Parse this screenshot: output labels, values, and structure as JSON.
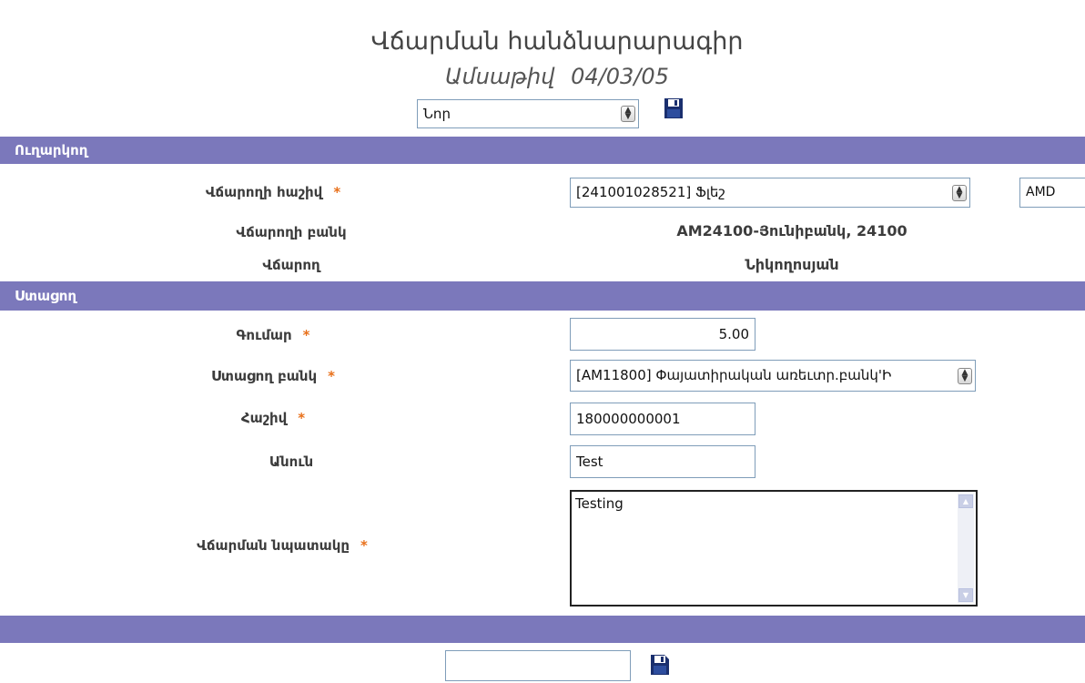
{
  "header": {
    "title": "Վճարման հանձնարարագիր",
    "date_label": "Ամսաթիվ",
    "date_value": "04/03/05",
    "template_select_value": "Նոր",
    "save_icon": "floppy-disk-icon"
  },
  "sender_section": {
    "title": "Ուղարկող",
    "payer_account_label": "Վճարողի հաշիվ",
    "payer_account_value": "[241001028521]  Ֆլեշ",
    "currency_value": "AMD",
    "payer_bank_label": "Վճարողի բանկ",
    "payer_bank_value": "AM24100-Յունիբանկ, 24100",
    "payer_label": "Վճարող",
    "payer_value": "Նիկողոսյան"
  },
  "receiver_section": {
    "title": "Ստացող",
    "amount_label": "Գումար",
    "amount_value": "5.00",
    "bank_label": "Ստացող բանկ",
    "bank_value": "[AM11800]  Փայատիրական առեւտր.բանկ'Ի",
    "account_label": "Հաշիվ",
    "account_value": "180000000001",
    "name_label": "Անուն",
    "name_value": "Test",
    "purpose_label": "Վճարման նպատակը",
    "purpose_value": "Testing"
  },
  "required_marker": "*",
  "footer": {
    "input_value": "",
    "save_icon": "floppy-disk-arrow-icon"
  },
  "colors": {
    "section_bar": "#7b78bb",
    "required_star": "#e8701a"
  }
}
